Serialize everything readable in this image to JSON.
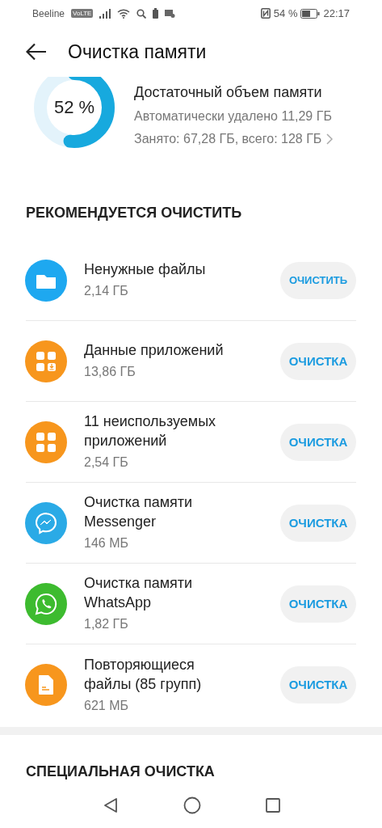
{
  "status_bar": {
    "carrier": "Beeline",
    "volte": "VoLTE",
    "battery_percent": "54 %",
    "time": "22:17"
  },
  "title_bar": {
    "title": "Очистка памяти"
  },
  "storage": {
    "percent": "52 %",
    "status": "Достаточный объем памяти",
    "auto_deleted": "Автоматически удалено 11,29 ГБ",
    "usage": "Занято: 67,28 ГБ, всего: 128 ГБ"
  },
  "recommended": {
    "header": "РЕКОМЕНДУЕТСЯ ОЧИСТИТЬ",
    "items": [
      {
        "kind": "folder",
        "color": "#1ea8f0",
        "title": "Ненужные файлы",
        "size": "2,14 ГБ",
        "button": "ОЧИСТИТЬ"
      },
      {
        "kind": "app-data",
        "color": "#f7961d",
        "title": "Данные приложений",
        "size": "13,86 ГБ",
        "button": "ОЧИСТКА"
      },
      {
        "kind": "apps",
        "color": "#f7961d",
        "title": "11 неиспользуемых приложений",
        "size": "2,54 ГБ",
        "button": "ОЧИСТКА"
      },
      {
        "kind": "messenger",
        "color": "#2aaae6",
        "title": "Очистка памяти Messenger",
        "size": "146 МБ",
        "button": "ОЧИСТКА"
      },
      {
        "kind": "whatsapp",
        "color": "#3dbb2f",
        "title": "Очистка памяти WhatsApp",
        "size": "1,82 ГБ",
        "button": "ОЧИСТКА"
      },
      {
        "kind": "file",
        "color": "#f7961d",
        "title": "Повторяющиеся файлы (85 групп)",
        "size": "621 МБ",
        "button": "ОЧИСТКА"
      }
    ]
  },
  "special": {
    "header": "СПЕЦИАЛЬНАЯ ОЧИСТКА"
  }
}
